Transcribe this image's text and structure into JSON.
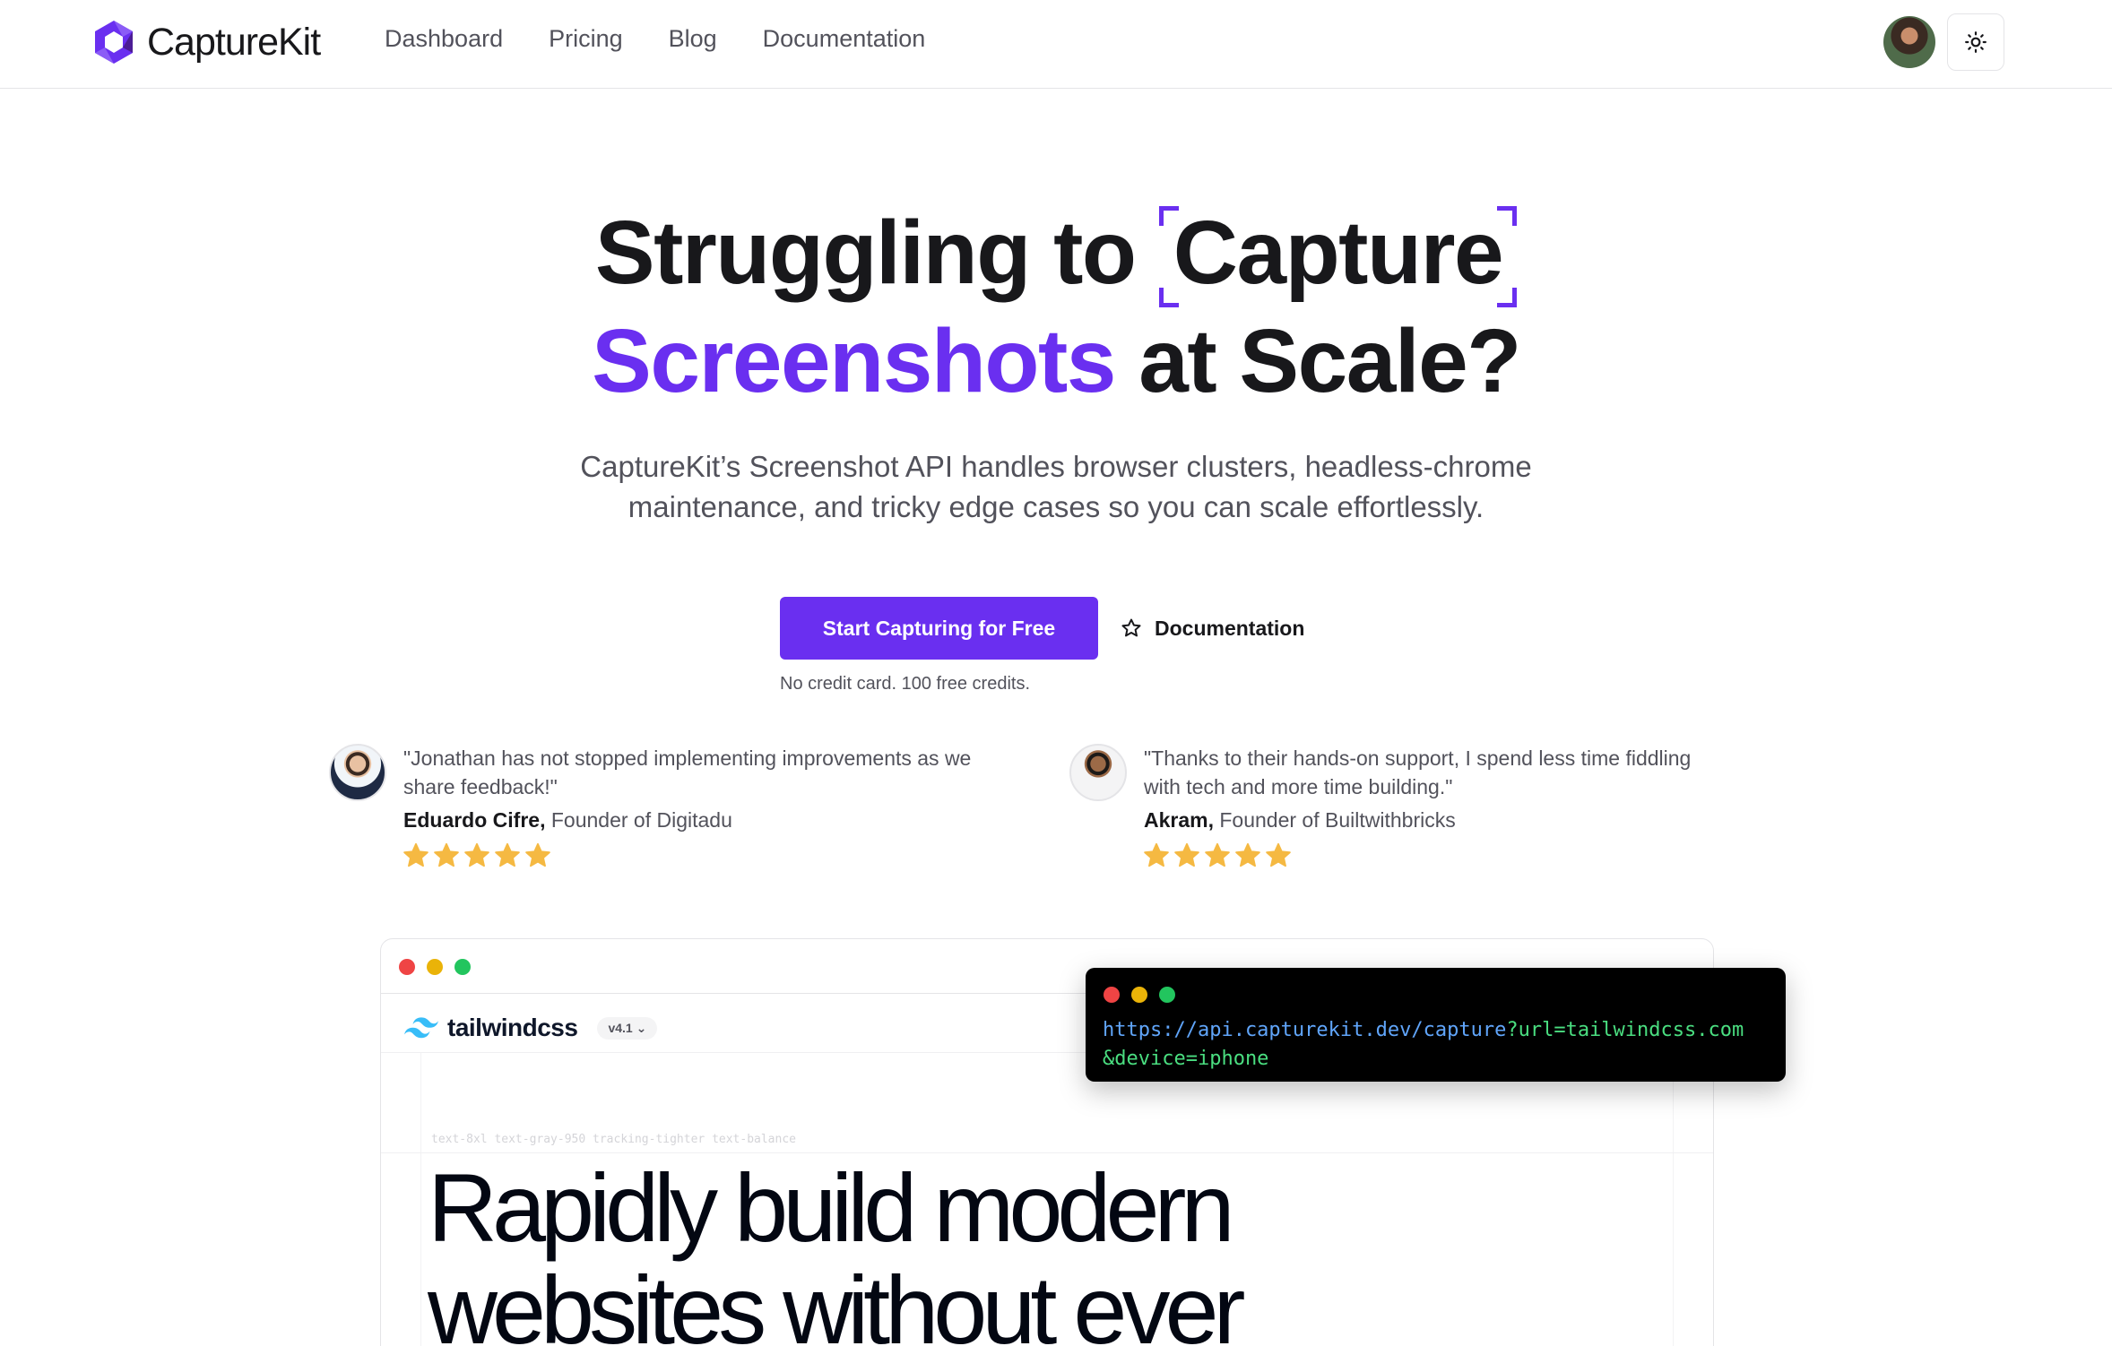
{
  "brand": {
    "name": "CaptureKit",
    "accent_color": "#6a2ff0"
  },
  "nav": {
    "links": [
      "Dashboard",
      "Pricing",
      "Blog",
      "Documentation"
    ],
    "avatar_icon": "user-avatar",
    "theme_icon": "sun-icon"
  },
  "hero": {
    "title_line1_prefix": "Struggling to",
    "title_capture": "Capture",
    "title_line2_accent": "Screenshots",
    "title_line2_rest": "at Scale?",
    "subtitle_line1": "CaptureKit’s Screenshot API handles browser clusters, headless-chrome",
    "subtitle_line2": "maintenance, and tricky edge cases so you can scale effortlessly.",
    "cta_primary": "Start Capturing for Free",
    "cta_secondary": "Documentation",
    "cta_note": "No credit card. 100 free credits."
  },
  "testimonials": [
    {
      "quote_line1": "\"Jonathan has not stopped implementing improvements as we",
      "quote_line2": "share feedback!\"",
      "name": "Eduardo Cifre,",
      "role": "Founder of Digitadu",
      "rating": 5
    },
    {
      "quote_line1": "\"Thanks to their hands-on support, I spend less time fiddling",
      "quote_line2": "with tech and more time building.\"",
      "name": "Akram,",
      "role": "Founder of Builtwithbricks",
      "rating": 5
    }
  ],
  "demo": {
    "site_name": "tailwindcss",
    "version": "v4.1",
    "class_hint": "text-8xl text-gray-950 tracking-tighter text-balance",
    "headline_line1": "Rapidly build modern",
    "headline_line2": "websites without ever"
  },
  "terminal": {
    "url": "https://api.capturekit.dev/capture",
    "params_line1": "?url=tailwindcss.com",
    "params_line2": "&device=iphone"
  },
  "colors": {
    "star": "#f5b942",
    "dot_red": "#ef4444",
    "dot_yellow": "#eab308",
    "dot_green": "#22c55e"
  }
}
